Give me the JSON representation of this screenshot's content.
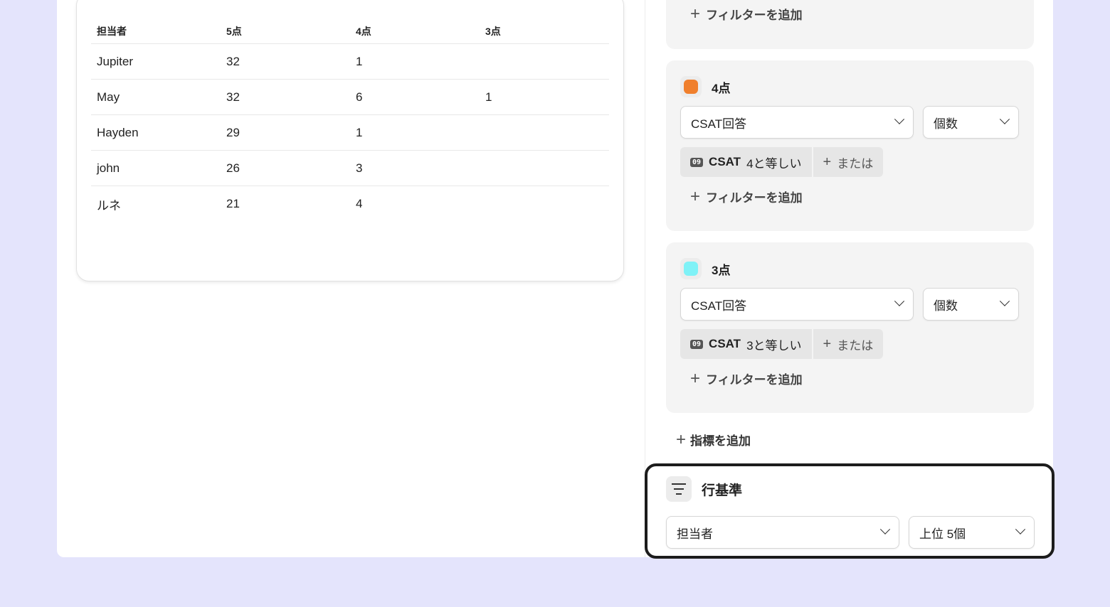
{
  "table": {
    "headers": [
      "担当者",
      "5点",
      "4点",
      "3点"
    ],
    "rows": [
      [
        "Jupiter",
        "32",
        "1",
        ""
      ],
      [
        "May",
        "32",
        "6",
        "1"
      ],
      [
        "Hayden",
        "29",
        "1",
        ""
      ],
      [
        "john",
        "26",
        "3",
        ""
      ],
      [
        "ルネ",
        "21",
        "4",
        ""
      ]
    ]
  },
  "top_panel": {
    "add_filter": "フィルターを追加"
  },
  "metrics": [
    {
      "label": "4点",
      "color": "#f07f2c",
      "field": "CSAT回答",
      "aggregation": "個数",
      "chip_icon": "09",
      "chip_field": "CSAT",
      "chip_condition": "4と等しい",
      "or_label": "または",
      "add_filter": "フィルターを追加"
    },
    {
      "label": "3点",
      "color": "#7ff2f7",
      "field": "CSAT回答",
      "aggregation": "個数",
      "chip_icon": "09",
      "chip_field": "CSAT",
      "chip_condition": "3と等しい",
      "or_label": "または",
      "add_filter": "フィルターを追加"
    }
  ],
  "add_metric": "指標を追加",
  "rows_section": {
    "title": "行基準",
    "dimension": "担当者",
    "limit": "上位 5個"
  },
  "icons": [
    "plus-icon",
    "chevron-down-icon",
    "number-field-icon",
    "filter-lines-icon"
  ]
}
